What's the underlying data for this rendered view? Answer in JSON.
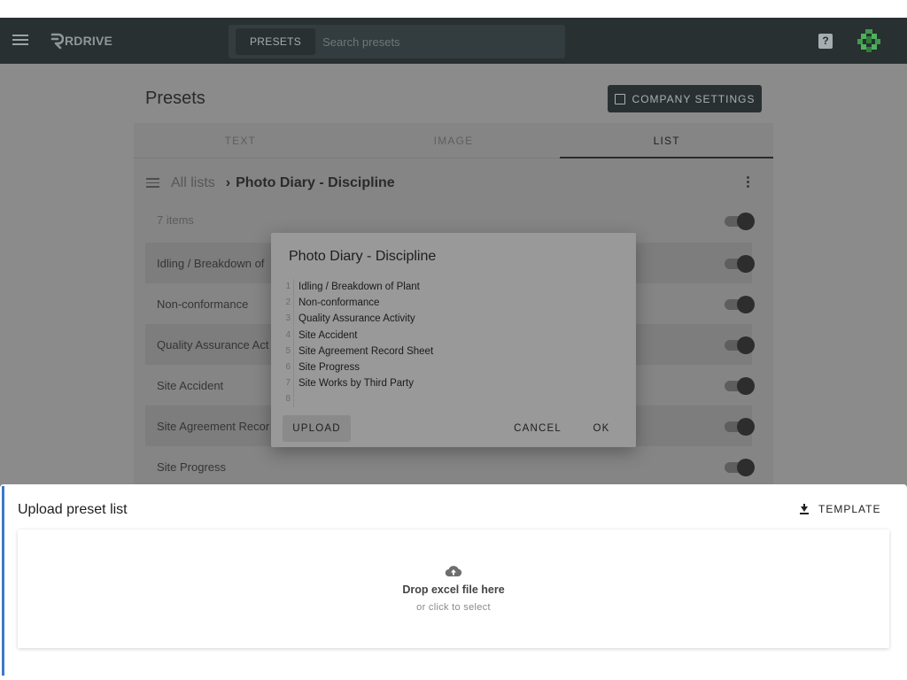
{
  "app": {
    "logo_text": "RDRIVE",
    "search_chip": "PRESETS",
    "search_placeholder": "Search presets",
    "help_icon": "?"
  },
  "page": {
    "title": "Presets",
    "company_settings": "COMPANY SETTINGS",
    "tabs": [
      {
        "label": "TEXT",
        "active": false
      },
      {
        "label": "IMAGE",
        "active": false
      },
      {
        "label": "LIST",
        "active": true
      }
    ],
    "breadcrumb": {
      "all": "All lists",
      "current": "Photo Diary - Discipline"
    },
    "count": "7 items",
    "rows": [
      "Idling / Breakdown of",
      "Non-conformance",
      "Quality Assurance Act",
      "Site Accident",
      "Site Agreement Recor",
      "Site Progress"
    ]
  },
  "dialog": {
    "title": "Photo Diary - Discipline",
    "lines": [
      {
        "n": "1",
        "text": "Idling / Breakdown of Plant"
      },
      {
        "n": "2",
        "text": "Non-conformance"
      },
      {
        "n": "3",
        "text": "Quality Assurance Activity"
      },
      {
        "n": "4",
        "text": "Site Accident"
      },
      {
        "n": "5",
        "text": "Site Agreement Record Sheet"
      },
      {
        "n": "6",
        "text": "Site Progress"
      },
      {
        "n": "7",
        "text": "Site Works by Third Party"
      },
      {
        "n": "8",
        "text": ""
      }
    ],
    "upload": "UPLOAD",
    "cancel": "CANCEL",
    "ok": "OK"
  },
  "sheet": {
    "title": "Upload preset list",
    "template": "TEMPLATE",
    "drop_title": "Drop excel file here",
    "drop_sub": "or click to select"
  },
  "colors": {
    "appbar": "#283032",
    "accent": "#3c78c8"
  }
}
